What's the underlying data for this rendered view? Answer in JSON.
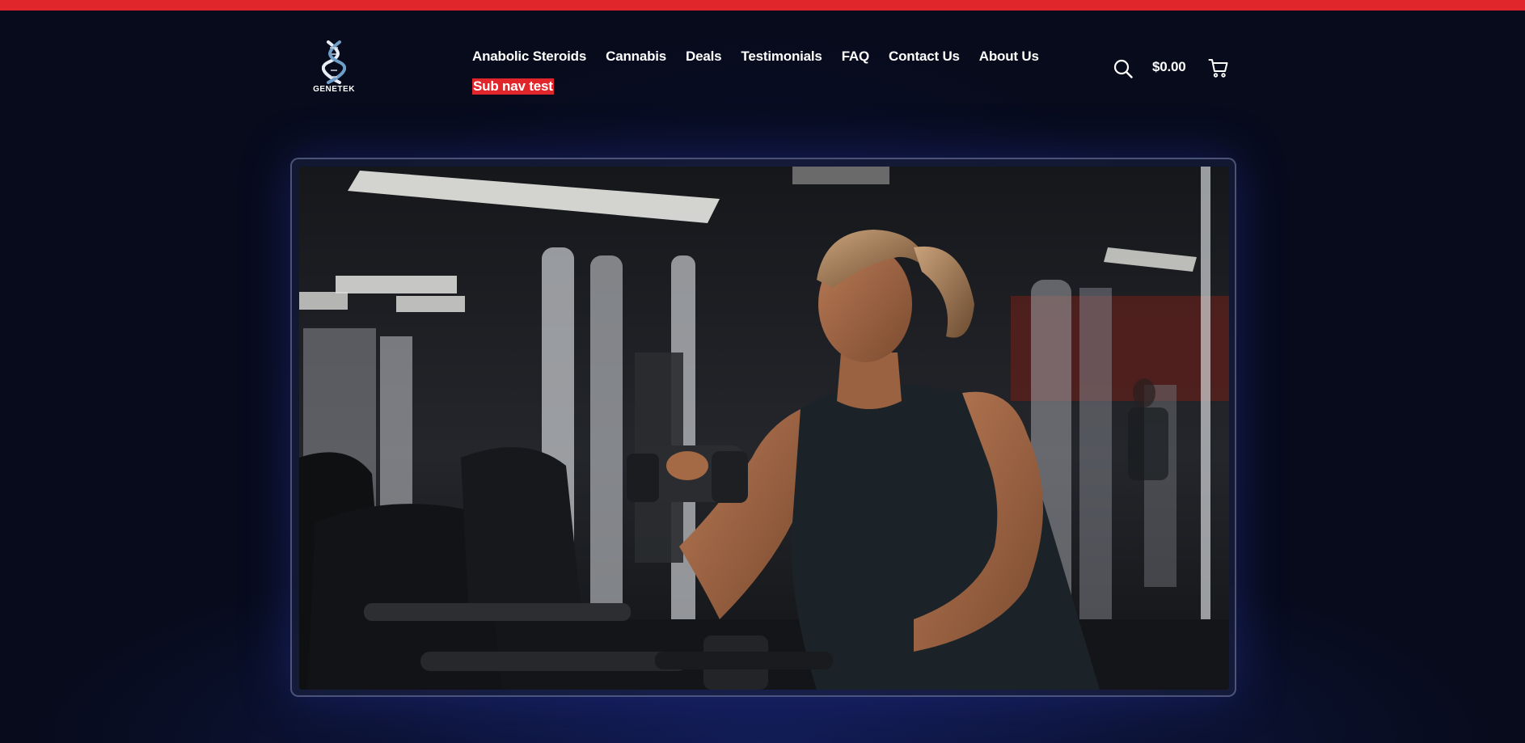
{
  "brand": {
    "name": "GENETEK",
    "accent_color": "#e0262a",
    "background_color": "#070b1c"
  },
  "header": {
    "logo_icon": "dna-helix-icon",
    "nav": [
      {
        "label": "Anabolic Steroids"
      },
      {
        "label": "Cannabis"
      },
      {
        "label": "Deals"
      },
      {
        "label": "Testimonials"
      },
      {
        "label": "FAQ"
      },
      {
        "label": "Contact Us"
      },
      {
        "label": "About Us"
      }
    ],
    "sub_nav": {
      "label": "Sub nav test"
    },
    "search_icon": "search-icon",
    "cart": {
      "total": "$0.00",
      "icon": "cart-icon"
    }
  },
  "hero": {
    "image_subject": "woman-lifting-dumbbell-in-gym"
  }
}
